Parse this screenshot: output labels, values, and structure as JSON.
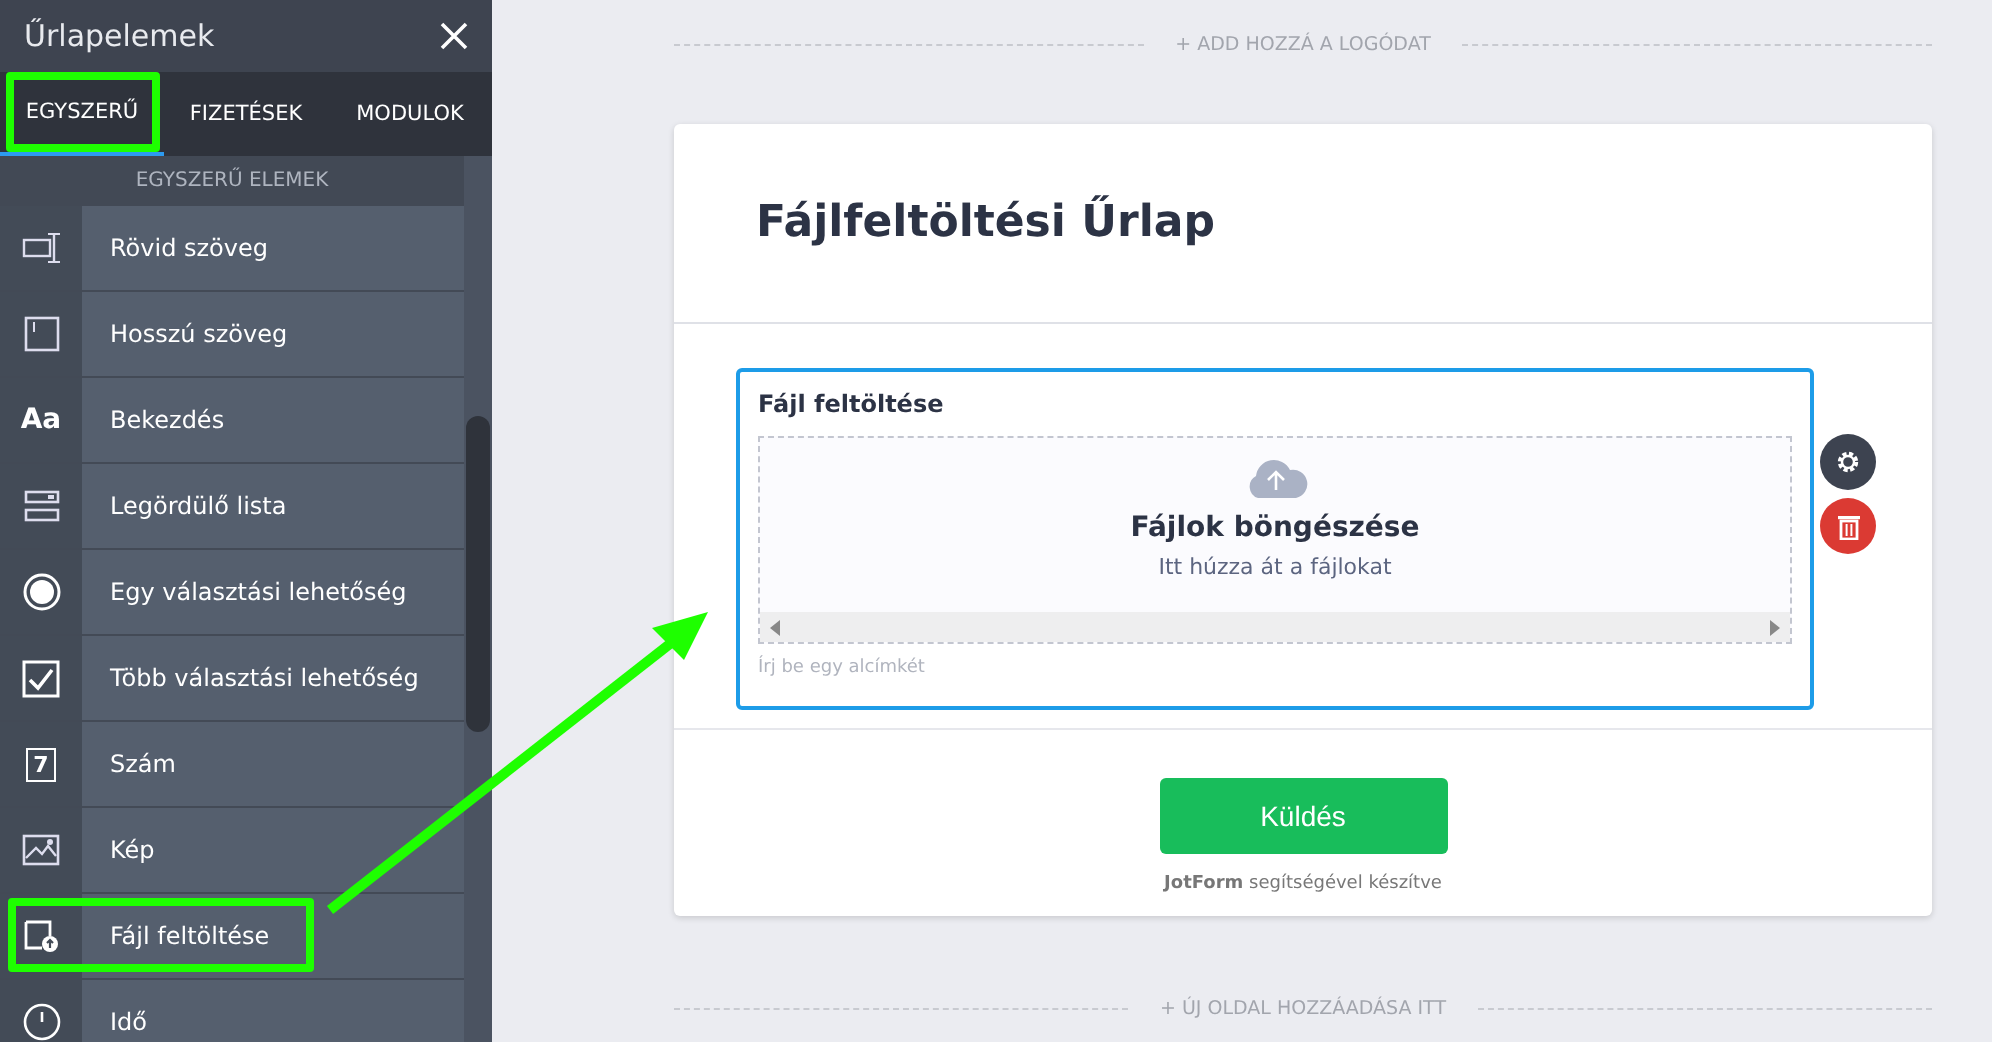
{
  "panel": {
    "title": "Űrlapelemek",
    "tabs": [
      {
        "label": "EGYSZERŰ",
        "selected": true,
        "highlighted": true
      },
      {
        "label": "FIZETÉSEK",
        "selected": false,
        "highlighted": false
      },
      {
        "label": "MODULOK",
        "selected": false,
        "highlighted": false
      }
    ],
    "section_title": "EGYSZERŰ ELEMEK",
    "items": [
      {
        "label": "Rövid szöveg",
        "kind": "short-text",
        "highlighted": false
      },
      {
        "label": "Hosszú szöveg",
        "kind": "long-text",
        "highlighted": false
      },
      {
        "label": "Bekezdés",
        "kind": "paragraph",
        "icon_text": "Aa",
        "highlighted": false
      },
      {
        "label": "Legördülő lista",
        "kind": "dropdown",
        "highlighted": false
      },
      {
        "label": "Egy választási lehetőség",
        "kind": "radio",
        "highlighted": false
      },
      {
        "label": "Több választási lehetőség",
        "kind": "checkbox",
        "highlighted": false
      },
      {
        "label": "Szám",
        "kind": "number",
        "icon_text": "7",
        "highlighted": false
      },
      {
        "label": "Kép",
        "kind": "image",
        "highlighted": false
      },
      {
        "label": "Fájl feltöltése",
        "kind": "file",
        "highlighted": true
      },
      {
        "label": "Idő",
        "kind": "time",
        "highlighted": false
      }
    ]
  },
  "canvas": {
    "logo_link": "+ ADD HOZZÁ A LOGÓDAT",
    "form_title": "Fájlfeltöltési Űrlap",
    "field": {
      "label": "Fájl feltöltése",
      "selected": true,
      "browse": "Fájlok böngészése",
      "hint": "Itt húzza át a fájlokat",
      "sublabel": {
        "placeholder": "Írj be egy alcímkét"
      }
    },
    "submit": "Küldés",
    "footer": "**JotForm** segítségével készítve",
    "add_page": "+ ÚJ OLDAL HOZZÁADÁSA ITT"
  }
}
